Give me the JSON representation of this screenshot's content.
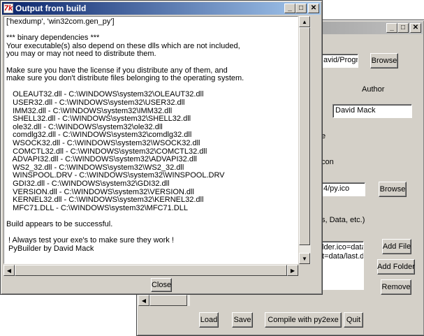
{
  "back_window": {
    "browse_path_value": "avid/Progr",
    "browse1_label": "Browse",
    "author_label": "Author",
    "author_value": "David Mack",
    "partial_label_1": "e",
    "partial_label_2": "con",
    "icon_value": "4/py.ico",
    "browse2_label": "Browse",
    "data_label": "s, Data, etc.)",
    "data_files": [
      "lder.ico=data/",
      "t=data/last.da"
    ],
    "add_file_label": "Add File",
    "add_folder_label": "Add Folder",
    "remove_label": "Remove",
    "load_label": "Load",
    "save_label": "Save",
    "compile_label": "Compile with py2exe",
    "quit_label": "Quit"
  },
  "front_window": {
    "title": "Output from build",
    "output_lines": [
      "['hexdump', 'win32com.gen_py']",
      "",
      "*** binary dependencies ***",
      "Your executable(s) also depend on these dlls which are not included,",
      "you may or may not need to distribute them.",
      "",
      "Make sure you have the license if you distribute any of them, and",
      "make sure you don't distribute files belonging to the operating system.",
      "",
      "   OLEAUT32.dll - C:\\WINDOWS\\system32\\OLEAUT32.dll",
      "   USER32.dll - C:\\WINDOWS\\system32\\USER32.dll",
      "   IMM32.dll - C:\\WINDOWS\\system32\\IMM32.dll",
      "   SHELL32.dll - C:\\WINDOWS\\system32\\SHELL32.dll",
      "   ole32.dll - C:\\WINDOWS\\system32\\ole32.dll",
      "   comdlg32.dll - C:\\WINDOWS\\system32\\comdlg32.dll",
      "   WSOCK32.dll - C:\\WINDOWS\\system32\\WSOCK32.dll",
      "   COMCTL32.dll - C:\\WINDOWS\\system32\\COMCTL32.dll",
      "   ADVAPI32.dll - C:\\WINDOWS\\system32\\ADVAPI32.dll",
      "   WS2_32.dll - C:\\WINDOWS\\system32\\WS2_32.dll",
      "   WINSPOOL.DRV - C:\\WINDOWS\\system32\\WINSPOOL.DRV",
      "   GDI32.dll - C:\\WINDOWS\\system32\\GDI32.dll",
      "   VERSION.dll - C:\\WINDOWS\\system32\\VERSION.dll",
      "   KERNEL32.dll - C:\\WINDOWS\\system32\\KERNEL32.dll",
      "   MFC71.DLL - C:\\WINDOWS\\system32\\MFC71.DLL",
      "",
      "Build appears to be successful.",
      "",
      " ! Always test your exe's to make sure they work !",
      " PyBuilder by David Mack"
    ],
    "close_label": "Close"
  }
}
